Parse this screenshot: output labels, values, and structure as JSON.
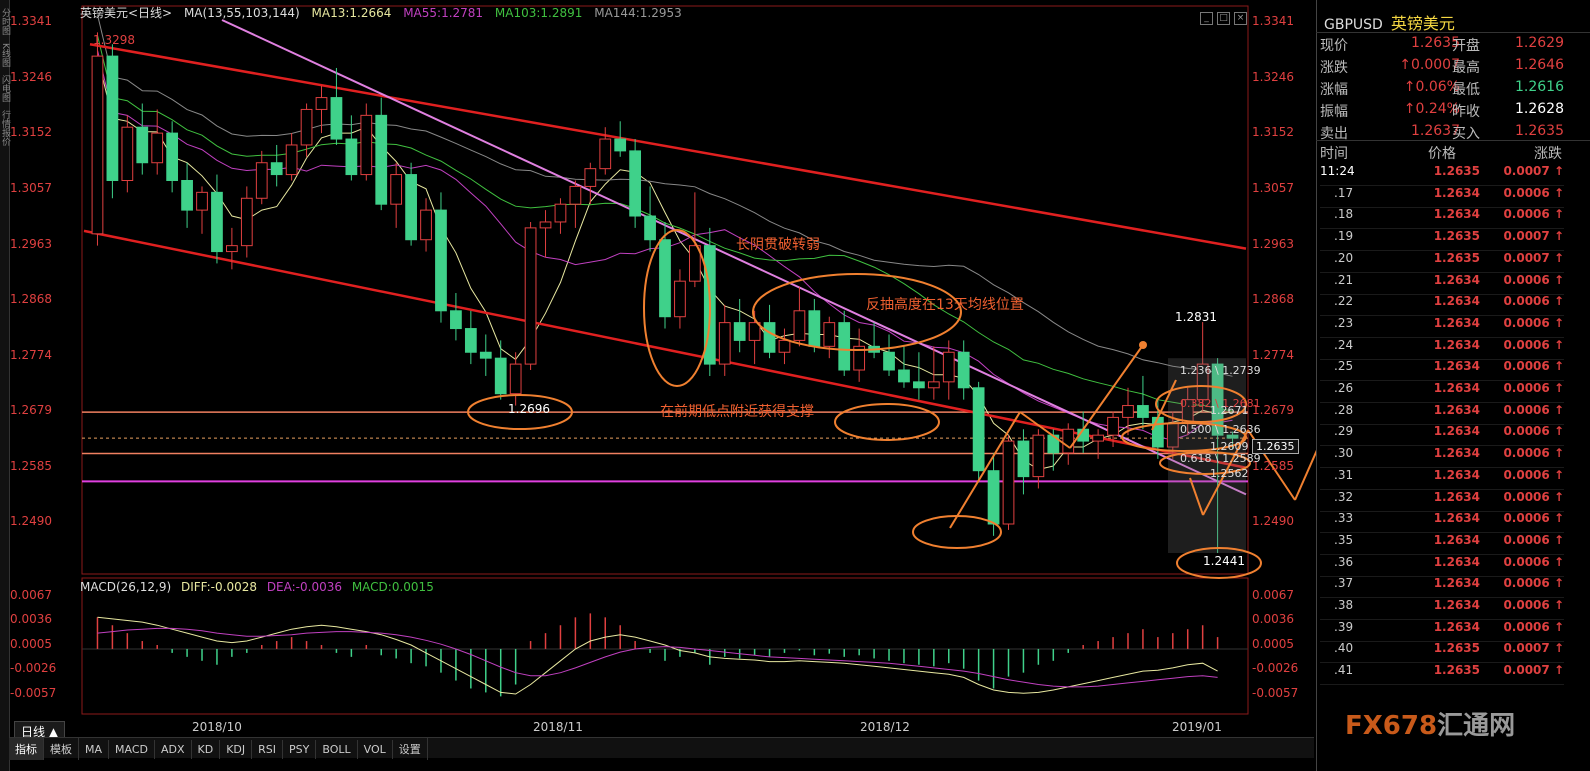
{
  "header": {
    "title": "英镑美元<日线>",
    "indicator": "MA(13,55,103,144)",
    "ma13": "MA13:1.2664",
    "ma55": "MA55:1.2781",
    "ma103": "MA103:1.2891",
    "ma144": "MA144:1.2953"
  },
  "macd_header": {
    "name": "MACD(26,12,9)",
    "diff": "DIFF:-0.0028",
    "dea": "DEA:-0.0036",
    "macd": "MACD:0.0015"
  },
  "left_strip": [
    "分时图",
    "K线图",
    "闪电图",
    "行情报价"
  ],
  "price_axis": [
    "1.3341",
    "1.3246",
    "1.3152",
    "1.3057",
    "1.2963",
    "1.2868",
    "1.2774",
    "1.2679",
    "1.2585",
    "1.2490"
  ],
  "macd_axis": [
    "0.0067",
    "0.0036",
    "0.0005",
    "-0.0026",
    "-0.0057"
  ],
  "x_axis": [
    "2018/10",
    "2018/11",
    "2018/12",
    "2019/01"
  ],
  "period_button": "日线 ▲",
  "bottom_tabs": [
    "指标",
    "模板",
    "MA",
    "MACD",
    "ADX",
    "KD",
    "KDJ",
    "RSI",
    "PSY",
    "BOLL",
    "VOL",
    "设置"
  ],
  "annotations": {
    "a1": "长阴贯破转弱",
    "a2": "反抽高度在13天均线位置",
    "a3": "在前期低点附近获得支撑",
    "hi_label": "1.3298",
    "low1": "1.2696",
    "high_recent": "1.2831",
    "low_recent": "1.2441",
    "fib1": "1.236 \\ 1.2739",
    "fib2": "0.382 \\ 1.2681",
    "fib3": "1.2671",
    "fib4": "0.500 \\ 1.2636",
    "fib5": "1.2609",
    "fib6": "0.618 \\ 1.2589",
    "fib7": "1.2562",
    "current_price_tag": "1.2635"
  },
  "quote": {
    "symbol": "GBPUSD",
    "name": "英镑美元",
    "rows": [
      {
        "k": "现价",
        "v": "1.2635",
        "k2": "开盘",
        "v2": "1.2629"
      },
      {
        "k": "涨跌",
        "v": "↑0.0007",
        "k2": "最高",
        "v2": "1.2646"
      },
      {
        "k": "涨幅",
        "v": "↑0.06%",
        "k2": "最低",
        "v2": "1.2616"
      },
      {
        "k": "振幅",
        "v": "↑0.24%",
        "k2": "昨收",
        "v2": "1.2628"
      },
      {
        "k": "卖出",
        "v": "1.2637",
        "k2": "买入",
        "v2": "1.2635"
      }
    ]
  },
  "ticks_header": {
    "time": "时间",
    "price": "价格",
    "change": "涨跌"
  },
  "ticks": [
    {
      "t": "11:24",
      "p": "1.2635",
      "c": "0.0007 ↑"
    },
    {
      "t": ".17",
      "p": "1.2634",
      "c": "0.0006 ↑"
    },
    {
      "t": ".18",
      "p": "1.2634",
      "c": "0.0006 ↑"
    },
    {
      "t": ".19",
      "p": "1.2635",
      "c": "0.0007 ↑"
    },
    {
      "t": ".20",
      "p": "1.2635",
      "c": "0.0007 ↑"
    },
    {
      "t": ".21",
      "p": "1.2634",
      "c": "0.0006 ↑"
    },
    {
      "t": ".22",
      "p": "1.2634",
      "c": "0.0006 ↑"
    },
    {
      "t": ".23",
      "p": "1.2634",
      "c": "0.0006 ↑"
    },
    {
      "t": ".24",
      "p": "1.2634",
      "c": "0.0006 ↑"
    },
    {
      "t": ".25",
      "p": "1.2634",
      "c": "0.0006 ↑"
    },
    {
      "t": ".26",
      "p": "1.2634",
      "c": "0.0006 ↑"
    },
    {
      "t": ".28",
      "p": "1.2634",
      "c": "0.0006 ↑"
    },
    {
      "t": ".29",
      "p": "1.2634",
      "c": "0.0006 ↑"
    },
    {
      "t": ".30",
      "p": "1.2634",
      "c": "0.0006 ↑"
    },
    {
      "t": ".31",
      "p": "1.2634",
      "c": "0.0006 ↑"
    },
    {
      "t": ".32",
      "p": "1.2634",
      "c": "0.0006 ↑"
    },
    {
      "t": ".33",
      "p": "1.2634",
      "c": "0.0006 ↑"
    },
    {
      "t": ".35",
      "p": "1.2634",
      "c": "0.0006 ↑"
    },
    {
      "t": ".36",
      "p": "1.2634",
      "c": "0.0006 ↑"
    },
    {
      "t": ".37",
      "p": "1.2634",
      "c": "0.0006 ↑"
    },
    {
      "t": ".38",
      "p": "1.2634",
      "c": "0.0006 ↑"
    },
    {
      "t": ".39",
      "p": "1.2634",
      "c": "0.0006 ↑"
    },
    {
      "t": ".40",
      "p": "1.2635",
      "c": "0.0007 ↑"
    },
    {
      "t": ".41",
      "p": "1.2635",
      "c": "0.0007 ↑"
    }
  ],
  "logo": {
    "a": "FX678",
    "b": "汇通网"
  },
  "colors": {
    "up": "#e04040",
    "down": "#3fd18a",
    "ma13": "#e8e8a0",
    "ma55": "#c040c0",
    "ma103": "#40c040",
    "ma144": "#888888",
    "trend": "#e02020",
    "pinkline": "#e080e0",
    "orange": "#f08030"
  },
  "chart_data": {
    "type": "candlestick",
    "title": "英镑美元<日线>",
    "ylim": [
      1.244,
      1.3341
    ],
    "ticks_y": [
      1.3341,
      1.3246,
      1.3152,
      1.3057,
      1.2963,
      1.2868,
      1.2774,
      1.2679,
      1.2585,
      1.249
    ],
    "x_ticks": [
      "2018/10",
      "2018/11",
      "2018/12",
      "2019/01"
    ],
    "candles": [
      [
        1.298,
        1.332,
        1.296,
        1.328
      ],
      [
        1.328,
        1.33,
        1.304,
        1.307
      ],
      [
        1.307,
        1.318,
        1.305,
        1.316
      ],
      [
        1.316,
        1.32,
        1.308,
        1.31
      ],
      [
        1.31,
        1.319,
        1.308,
        1.315
      ],
      [
        1.315,
        1.317,
        1.305,
        1.307
      ],
      [
        1.307,
        1.31,
        1.299,
        1.302
      ],
      [
        1.302,
        1.306,
        1.298,
        1.305
      ],
      [
        1.305,
        1.308,
        1.293,
        1.295
      ],
      [
        1.295,
        1.299,
        1.292,
        1.296
      ],
      [
        1.296,
        1.306,
        1.294,
        1.304
      ],
      [
        1.304,
        1.312,
        1.303,
        1.31
      ],
      [
        1.31,
        1.313,
        1.306,
        1.308
      ],
      [
        1.308,
        1.315,
        1.307,
        1.313
      ],
      [
        1.313,
        1.32,
        1.311,
        1.319
      ],
      [
        1.319,
        1.323,
        1.315,
        1.321
      ],
      [
        1.321,
        1.326,
        1.313,
        1.314
      ],
      [
        1.314,
        1.318,
        1.307,
        1.308
      ],
      [
        1.308,
        1.32,
        1.307,
        1.318
      ],
      [
        1.318,
        1.321,
        1.302,
        1.303
      ],
      [
        1.303,
        1.31,
        1.299,
        1.308
      ],
      [
        1.308,
        1.31,
        1.296,
        1.297
      ],
      [
        1.297,
        1.304,
        1.295,
        1.302
      ],
      [
        1.302,
        1.305,
        1.283,
        1.285
      ],
      [
        1.285,
        1.288,
        1.28,
        1.282
      ],
      [
        1.282,
        1.285,
        1.276,
        1.278
      ],
      [
        1.278,
        1.281,
        1.274,
        1.277
      ],
      [
        1.277,
        1.28,
        1.27,
        1.271
      ],
      [
        1.271,
        1.278,
        1.269,
        1.276
      ],
      [
        1.276,
        1.3,
        1.275,
        1.299
      ],
      [
        1.299,
        1.302,
        1.294,
        1.3
      ],
      [
        1.3,
        1.304,
        1.298,
        1.303
      ],
      [
        1.303,
        1.307,
        1.299,
        1.306
      ],
      [
        1.306,
        1.31,
        1.303,
        1.309
      ],
      [
        1.309,
        1.316,
        1.308,
        1.314
      ],
      [
        1.314,
        1.317,
        1.311,
        1.312
      ],
      [
        1.312,
        1.314,
        1.299,
        1.301
      ],
      [
        1.301,
        1.306,
        1.295,
        1.297
      ],
      [
        1.297,
        1.3,
        1.282,
        1.284
      ],
      [
        1.284,
        1.292,
        1.282,
        1.29
      ],
      [
        1.29,
        1.305,
        1.289,
        1.296
      ],
      [
        1.296,
        1.299,
        1.274,
        1.276
      ],
      [
        1.276,
        1.286,
        1.274,
        1.283
      ],
      [
        1.283,
        1.287,
        1.278,
        1.28
      ],
      [
        1.28,
        1.285,
        1.276,
        1.283
      ],
      [
        1.283,
        1.286,
        1.277,
        1.278
      ],
      [
        1.278,
        1.282,
        1.276,
        1.28
      ],
      [
        1.28,
        1.289,
        1.279,
        1.285
      ],
      [
        1.285,
        1.287,
        1.278,
        1.279
      ],
      [
        1.279,
        1.284,
        1.277,
        1.283
      ],
      [
        1.283,
        1.285,
        1.274,
        1.275
      ],
      [
        1.275,
        1.282,
        1.273,
        1.279
      ],
      [
        1.279,
        1.283,
        1.277,
        1.278
      ],
      [
        1.278,
        1.281,
        1.274,
        1.275
      ],
      [
        1.275,
        1.279,
        1.272,
        1.273
      ],
      [
        1.273,
        1.278,
        1.27,
        1.272
      ],
      [
        1.272,
        1.279,
        1.27,
        1.273
      ],
      [
        1.273,
        1.28,
        1.27,
        1.278
      ],
      [
        1.278,
        1.28,
        1.27,
        1.272
      ],
      [
        1.272,
        1.273,
        1.256,
        1.258
      ],
      [
        1.258,
        1.261,
        1.247,
        1.249
      ],
      [
        1.249,
        1.264,
        1.248,
        1.263
      ],
      [
        1.263,
        1.265,
        1.254,
        1.257
      ],
      [
        1.257,
        1.265,
        1.255,
        1.264
      ],
      [
        1.264,
        1.265,
        1.258,
        1.261
      ],
      [
        1.261,
        1.266,
        1.259,
        1.265
      ],
      [
        1.265,
        1.268,
        1.261,
        1.263
      ],
      [
        1.263,
        1.265,
        1.26,
        1.264
      ],
      [
        1.264,
        1.268,
        1.262,
        1.267
      ],
      [
        1.267,
        1.272,
        1.264,
        1.269
      ],
      [
        1.269,
        1.274,
        1.265,
        1.267
      ],
      [
        1.267,
        1.27,
        1.26,
        1.262
      ],
      [
        1.262,
        1.268,
        1.26,
        1.266
      ],
      [
        1.266,
        1.272,
        1.264,
        1.27
      ],
      [
        1.27,
        1.2831,
        1.268,
        1.276
      ],
      [
        1.276,
        1.277,
        1.2441,
        1.264
      ],
      [
        1.264,
        1.2646,
        1.2616,
        1.2635
      ]
    ],
    "macd": [
      0.004,
      0.003,
      0.002,
      0.001,
      0.0005,
      -0.0005,
      -0.001,
      -0.0015,
      -0.002,
      -0.001,
      -0.0005,
      0.0005,
      0.001,
      0.0015,
      0.001,
      0.0005,
      -0.0005,
      -0.001,
      0.0005,
      -0.0008,
      -0.0012,
      -0.0018,
      -0.0022,
      -0.003,
      -0.004,
      -0.005,
      -0.0055,
      -0.006,
      -0.0045,
      0.001,
      0.002,
      0.003,
      0.004,
      0.0045,
      0.004,
      0.003,
      0.001,
      -0.0005,
      -0.0015,
      -0.001,
      -0.0005,
      -0.002,
      -0.001,
      -0.0012,
      -0.0008,
      -0.001,
      -0.0005,
      -0.0002,
      -0.0008,
      -0.0006,
      -0.001,
      -0.0008,
      -0.0012,
      -0.0015,
      -0.0018,
      -0.002,
      -0.0022,
      -0.0018,
      -0.0025,
      -0.004,
      -0.005,
      -0.0035,
      -0.003,
      -0.002,
      -0.0015,
      -0.0005,
      0.0005,
      0.001,
      0.0015,
      0.002,
      0.0025,
      0.0015,
      0.002,
      0.0025,
      0.003,
      0.0015
    ],
    "diff": [
      0.004,
      0.0038,
      0.0036,
      0.0034,
      0.003,
      0.0025,
      0.002,
      0.0015,
      0.001,
      0.0008,
      0.001,
      0.0015,
      0.002,
      0.0025,
      0.0028,
      0.003,
      0.0028,
      0.0025,
      0.0022,
      0.0018,
      0.0012,
      0.0005,
      -0.0005,
      -0.0015,
      -0.0025,
      -0.0035,
      -0.0045,
      -0.0055,
      -0.0057,
      -0.0045,
      -0.003,
      -0.0015,
      0.0,
      0.001,
      0.0015,
      0.0018,
      0.0015,
      0.001,
      0.0005,
      -0.0002,
      -0.0005,
      -0.001,
      -0.0012,
      -0.0013,
      -0.0014,
      -0.0016,
      -0.0016,
      -0.0015,
      -0.0016,
      -0.0017,
      -0.0018,
      -0.002,
      -0.0022,
      -0.0024,
      -0.0026,
      -0.0028,
      -0.003,
      -0.0032,
      -0.0036,
      -0.0045,
      -0.0052,
      -0.0055,
      -0.0056,
      -0.0055,
      -0.0052,
      -0.0048,
      -0.0044,
      -0.004,
      -0.0036,
      -0.0032,
      -0.0028,
      -0.0027,
      -0.0024,
      -0.002,
      -0.0018,
      -0.0028
    ],
    "dea": [
      0.002,
      0.0022,
      0.0024,
      0.0025,
      0.0026,
      0.0026,
      0.0025,
      0.0023,
      0.002,
      0.0018,
      0.0016,
      0.0016,
      0.0017,
      0.0018,
      0.002,
      0.0021,
      0.0022,
      0.0022,
      0.0021,
      0.002,
      0.0018,
      0.0015,
      0.0011,
      0.0006,
      0.0,
      -0.0007,
      -0.0015,
      -0.0023,
      -0.003,
      -0.0034,
      -0.0034,
      -0.003,
      -0.0024,
      -0.0017,
      -0.001,
      -0.0004,
      0.0,
      0.0002,
      0.0003,
      0.0002,
      0.0,
      -0.0002,
      -0.0004,
      -0.0006,
      -0.0008,
      -0.001,
      -0.0011,
      -0.0012,
      -0.0013,
      -0.0014,
      -0.0015,
      -0.0016,
      -0.0017,
      -0.0018,
      -0.002,
      -0.0022,
      -0.0024,
      -0.0026,
      -0.0028,
      -0.0031,
      -0.0035,
      -0.0039,
      -0.0042,
      -0.0045,
      -0.0047,
      -0.0048,
      -0.0048,
      -0.0047,
      -0.0045,
      -0.0043,
      -0.0041,
      -0.0039,
      -0.0037,
      -0.0035,
      -0.0034,
      -0.0036
    ]
  }
}
